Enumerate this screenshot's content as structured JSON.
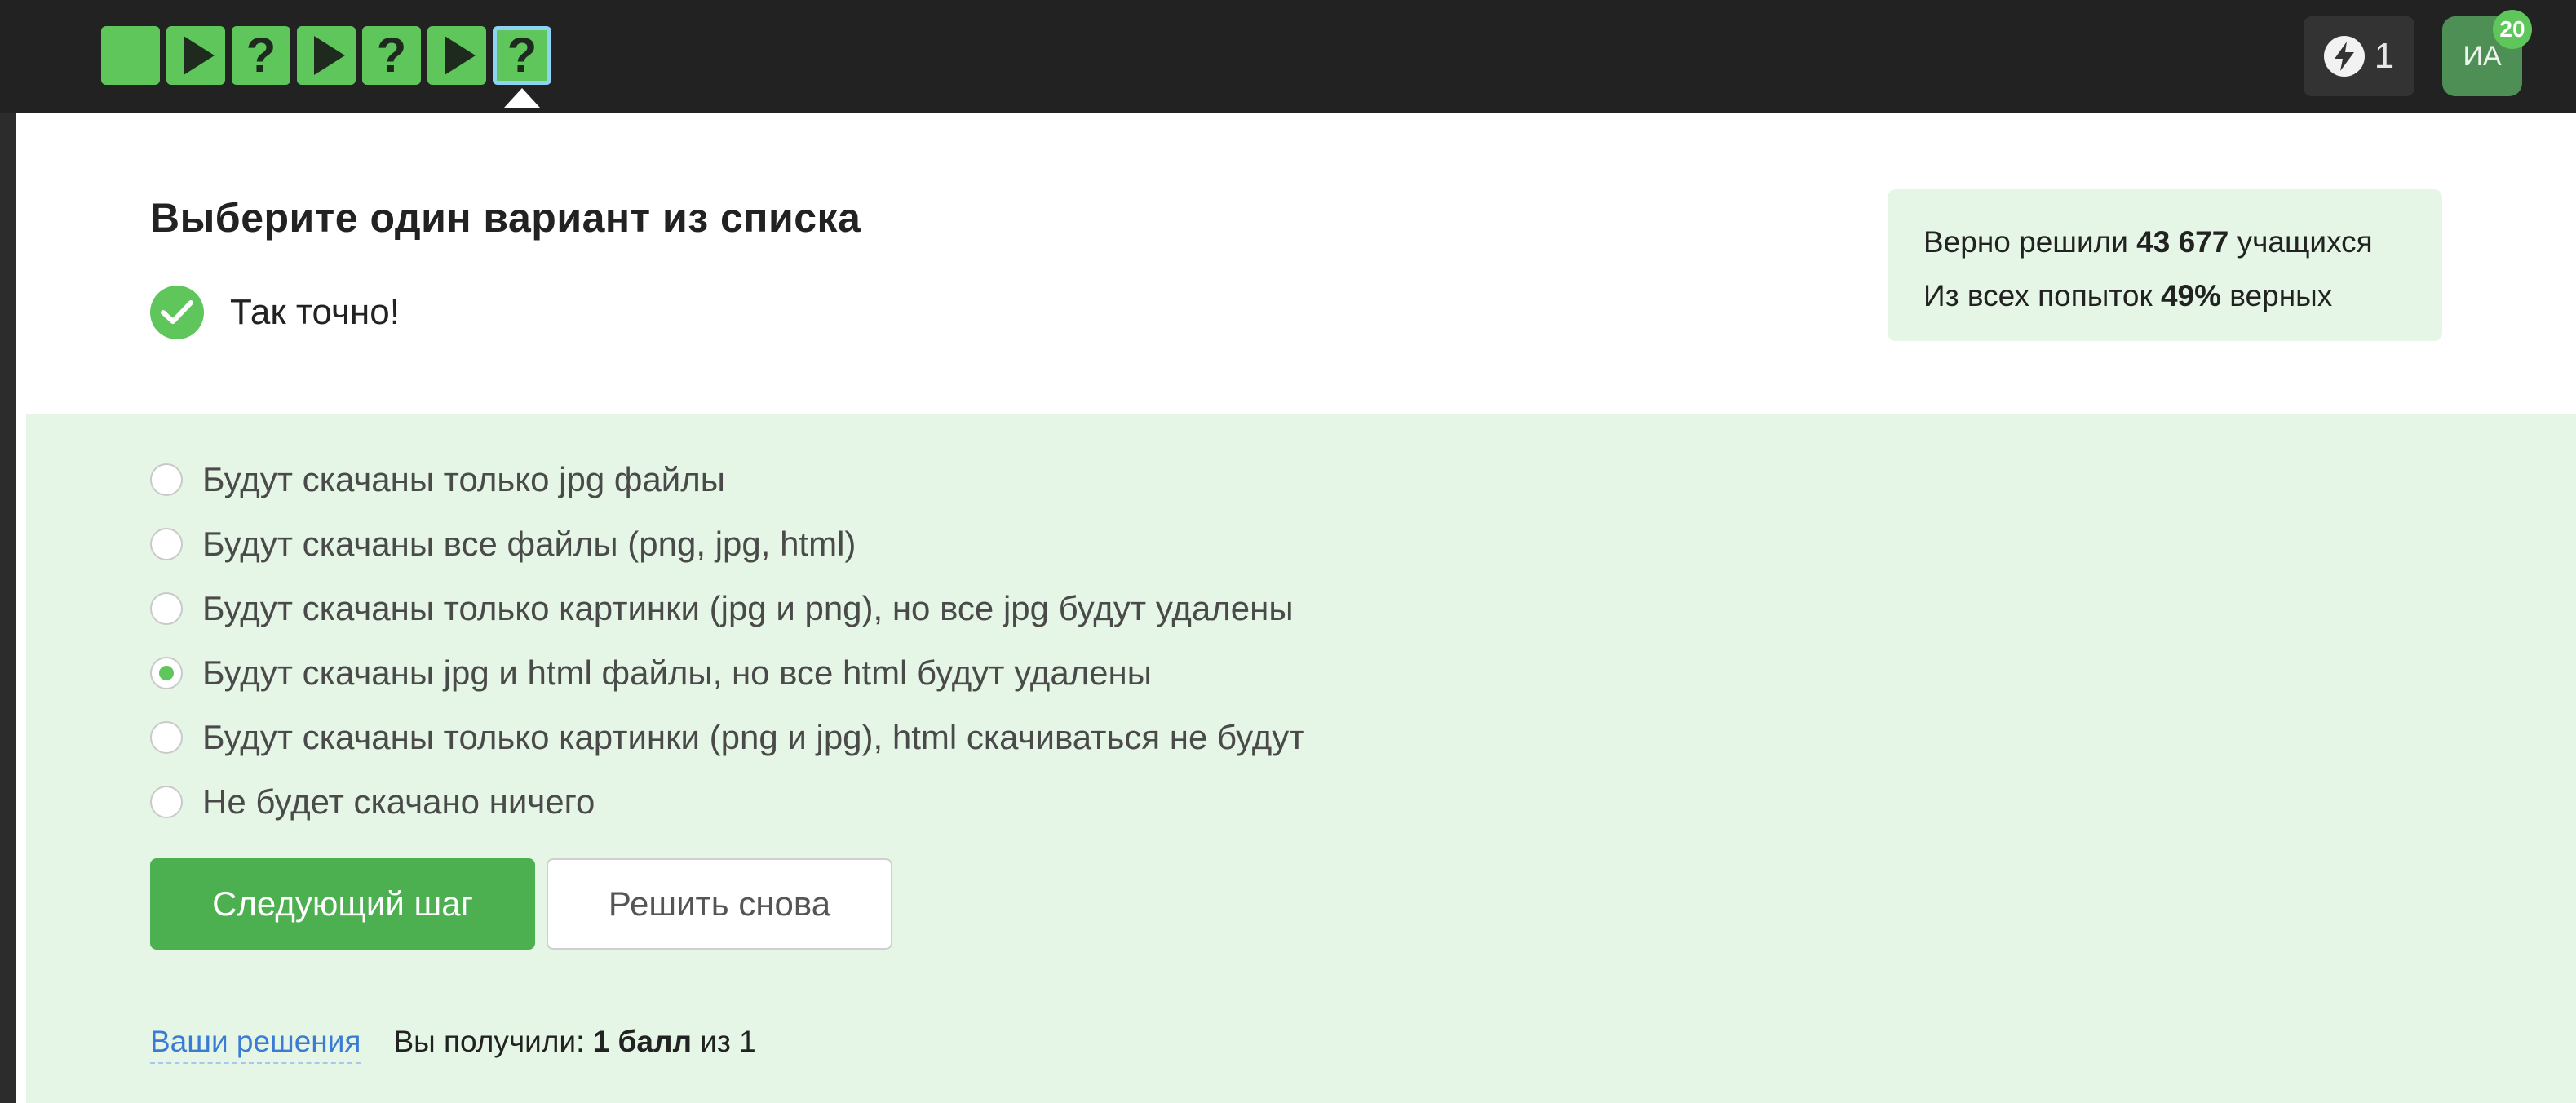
{
  "topbar": {
    "steps": [
      {
        "kind": "text",
        "status": "passed"
      },
      {
        "kind": "video",
        "status": "passed"
      },
      {
        "kind": "quiz",
        "status": "passed"
      },
      {
        "kind": "video",
        "status": "passed"
      },
      {
        "kind": "quiz",
        "status": "passed"
      },
      {
        "kind": "video",
        "status": "passed"
      },
      {
        "kind": "quiz",
        "status": "current"
      }
    ],
    "quiz_symbol": "?",
    "energy_count": "1",
    "avatar_initials": "ИА",
    "avatar_badge": "20"
  },
  "question": {
    "title": "Выберите один вариант из списка",
    "result_text": "Так точно!"
  },
  "stats": {
    "line1_prefix": "Верно решили",
    "line1_value": "43 677",
    "line1_suffix": "учащихся",
    "line2_prefix": "Из всех попыток",
    "line2_value": "49%",
    "line2_suffix": "верных"
  },
  "options": [
    {
      "label": "Будут скачаны только jpg файлы",
      "selected": false
    },
    {
      "label": "Будут скачаны все файлы (png, jpg, html)",
      "selected": false
    },
    {
      "label": "Будут скачаны только картинки (jpg и png), но все jpg будут удалены",
      "selected": false
    },
    {
      "label": "Будут скачаны jpg и html файлы, но все html будут удалены",
      "selected": true
    },
    {
      "label": "Будут скачаны только картинки (png и jpg), html скачиваться не будут",
      "selected": false
    },
    {
      "label": "Не будет скачано ничего",
      "selected": false
    }
  ],
  "buttons": {
    "next": "Следующий шаг",
    "retry": "Решить снова"
  },
  "footer": {
    "solutions_link": "Ваши решения",
    "score_prefix": "Вы получили:",
    "score_value": "1 балл",
    "score_suffix": "из 1"
  },
  "colors": {
    "accent_green": "#5fc65b",
    "button_green": "#4caf50",
    "answer_background": "#e6f6e6",
    "link_blue": "#3a7bd5"
  }
}
